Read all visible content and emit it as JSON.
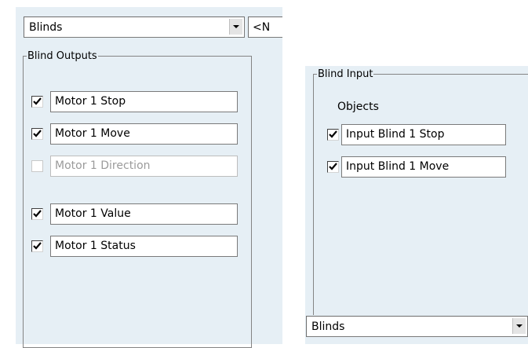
{
  "left_panel": {
    "module_combo": {
      "value": "Blinds"
    },
    "second_combo_value": "<N",
    "group_title": "Blind Outputs",
    "outputs": [
      {
        "label": "Motor 1 Stop",
        "checked": true,
        "enabled": true
      },
      {
        "label": "Motor 1 Move",
        "checked": true,
        "enabled": true
      },
      {
        "label": "Motor 1 Direction",
        "checked": false,
        "enabled": false
      },
      {
        "label": "Motor 1 Value",
        "checked": true,
        "enabled": true
      },
      {
        "label": "Motor 1 Status",
        "checked": true,
        "enabled": true
      }
    ]
  },
  "right_panel": {
    "group_title": "Blind Input",
    "objects_label": "Objects",
    "inputs": [
      {
        "label": "Input Blind 1 Stop",
        "checked": true
      },
      {
        "label": "Input Blind 1 Move",
        "checked": true
      }
    ],
    "module_combo": {
      "value": "Blinds"
    }
  },
  "icons": {
    "checkmark": "checkmark-icon",
    "dropdown": "chevron-down-icon"
  },
  "colors": {
    "panel_bg": "#e6eff5",
    "group_border": "#848484",
    "disabled_text": "#9b9b9b"
  }
}
